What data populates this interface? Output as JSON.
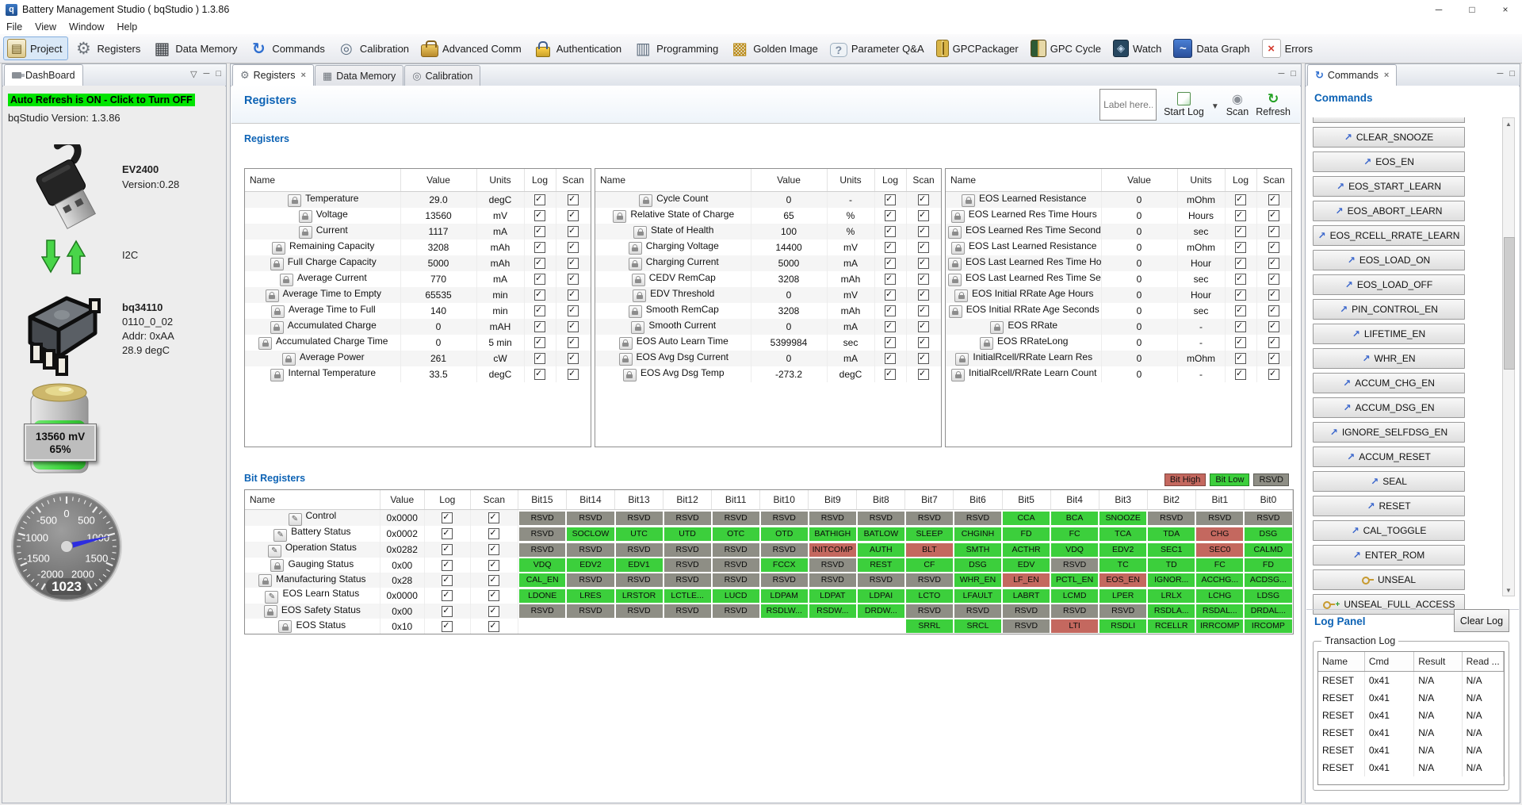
{
  "titlebar": {
    "title": "Battery Management Studio ( bqStudio ) 1.3.86"
  },
  "menubar": [
    "File",
    "View",
    "Window",
    "Help"
  ],
  "toolbar": [
    {
      "id": "project",
      "label": "Project",
      "selected": true
    },
    {
      "id": "registers",
      "label": "Registers",
      "selected": false
    },
    {
      "id": "data-memory",
      "label": "Data Memory",
      "selected": false
    },
    {
      "id": "commands",
      "label": "Commands",
      "selected": false
    },
    {
      "id": "calibration",
      "label": "Calibration",
      "selected": false
    },
    {
      "id": "advanced-comm",
      "label": "Advanced Comm",
      "selected": false
    },
    {
      "id": "authentication",
      "label": "Authentication",
      "selected": false
    },
    {
      "id": "programming",
      "label": "Programming",
      "selected": false
    },
    {
      "id": "golden-image",
      "label": "Golden Image",
      "selected": false
    },
    {
      "id": "parameter-qa",
      "label": "Parameter Q&A",
      "selected": false
    },
    {
      "id": "gpcpackager",
      "label": "GPCPackager",
      "selected": false
    },
    {
      "id": "gpc-cycle",
      "label": "GPC Cycle",
      "selected": false
    },
    {
      "id": "watch",
      "label": "Watch",
      "selected": false
    },
    {
      "id": "data-graph",
      "label": "Data Graph",
      "selected": false
    },
    {
      "id": "errors",
      "label": "Errors",
      "selected": false
    }
  ],
  "dashboard": {
    "tab": "DashBoard",
    "banner": "Auto Refresh is ON - Click to Turn OFF",
    "version": "bqStudio Version:  1.3.86",
    "adapter_name": "EV2400",
    "adapter_version": "Version:0.28",
    "bus_label": "I2C",
    "device": {
      "name": "bq34110",
      "fw": "0110_0_02",
      "addr": "Addr: 0xAA",
      "temp": "28.9 degC"
    },
    "battery": {
      "voltage": "13560 mV",
      "soc": "65%"
    },
    "gauge": {
      "tick_labels": [
        "0",
        "-500",
        "500",
        "-1000",
        "1000",
        "-1500",
        "1500",
        "-2000",
        "2000"
      ],
      "value": "1023"
    }
  },
  "main": {
    "tabs": [
      {
        "label": "Registers",
        "icon": "gear",
        "active": true,
        "closable": true
      },
      {
        "label": "Data Memory",
        "icon": "chip",
        "active": false,
        "closable": false
      },
      {
        "label": "Calibration",
        "icon": "magnifier",
        "active": false,
        "closable": false
      }
    ],
    "page_title": "Registers",
    "label_placeholder": "Label here...",
    "actions": {
      "start_log": "Start Log",
      "scan": "Scan",
      "refresh": "Refresh"
    },
    "registers_section_title": "Registers",
    "reg_columns": [
      "Name",
      "Value",
      "Units",
      "Log",
      "Scan"
    ],
    "reg_tables": [
      [
        [
          "Temperature",
          "29.0",
          "degC"
        ],
        [
          "Voltage",
          "13560",
          "mV"
        ],
        [
          "Current",
          "1117",
          "mA"
        ],
        [
          "Remaining Capacity",
          "3208",
          "mAh"
        ],
        [
          "Full Charge Capacity",
          "5000",
          "mAh"
        ],
        [
          "Average Current",
          "770",
          "mA"
        ],
        [
          "Average Time to Empty",
          "65535",
          "min"
        ],
        [
          "Average Time to Full",
          "140",
          "min"
        ],
        [
          "Accumulated Charge",
          "0",
          "mAH"
        ],
        [
          "Accumulated Charge Time",
          "0",
          "5 min"
        ],
        [
          "Average Power",
          "261",
          "cW"
        ],
        [
          "Internal Temperature",
          "33.5",
          "degC"
        ]
      ],
      [
        [
          "Cycle Count",
          "0",
          "-"
        ],
        [
          "Relative State of Charge",
          "65",
          "%"
        ],
        [
          "State of Health",
          "100",
          "%"
        ],
        [
          "Charging Voltage",
          "14400",
          "mV"
        ],
        [
          "Charging Current",
          "5000",
          "mA"
        ],
        [
          "CEDV RemCap",
          "3208",
          "mAh"
        ],
        [
          "EDV Threshold",
          "0",
          "mV"
        ],
        [
          "Smooth RemCap",
          "3208",
          "mAh"
        ],
        [
          "Smooth Current",
          "0",
          "mA"
        ],
        [
          "EOS Auto Learn Time",
          "5399984",
          "sec"
        ],
        [
          "EOS Avg Dsg Current",
          "0",
          "mA"
        ],
        [
          "EOS Avg Dsg Temp",
          "-273.2",
          "degC"
        ]
      ],
      [
        [
          "EOS Learned Resistance",
          "0",
          "mOhm"
        ],
        [
          "EOS Learned Res Time Hours",
          "0",
          "Hours"
        ],
        [
          "EOS Learned Res Time Seconds",
          "0",
          "sec"
        ],
        [
          "EOS Last Learned Resistance",
          "0",
          "mOhm"
        ],
        [
          "EOS Last Learned Res Time Ho...",
          "0",
          "Hour"
        ],
        [
          "EOS Last Learned Res Time Se...",
          "0",
          "sec"
        ],
        [
          "EOS Initial RRate Age Hours",
          "0",
          "Hour"
        ],
        [
          "EOS Initial RRate Age Seconds",
          "0",
          "sec"
        ],
        [
          "EOS RRate",
          "0",
          "-"
        ],
        [
          "EOS RRateLong",
          "0",
          "-"
        ],
        [
          "InitialRcell/RRate Learn Res",
          "0",
          "mOhm"
        ],
        [
          "InitialRcell/RRate Learn Count",
          "0",
          "-"
        ]
      ]
    ],
    "bit_section_title": "Bit Registers",
    "bit_legend": [
      {
        "label": "Bit High",
        "type": "high"
      },
      {
        "label": "Bit Low",
        "type": "low"
      },
      {
        "label": "RSVD",
        "type": "rsvd"
      }
    ],
    "bit_columns": [
      "Name",
      "Value",
      "Log",
      "Scan",
      "Bit15",
      "Bit14",
      "Bit13",
      "Bit12",
      "Bit11",
      "Bit10",
      "Bit9",
      "Bit8",
      "Bit7",
      "Bit6",
      "Bit5",
      "Bit4",
      "Bit3",
      "Bit2",
      "Bit1",
      "Bit0"
    ],
    "bit_rows": [
      {
        "name": "Control",
        "value": "0x0000",
        "icon": "pencil",
        "bits": [
          [
            "RSVD",
            "rsvd"
          ],
          [
            "RSVD",
            "rsvd"
          ],
          [
            "RSVD",
            "rsvd"
          ],
          [
            "RSVD",
            "rsvd"
          ],
          [
            "RSVD",
            "rsvd"
          ],
          [
            "RSVD",
            "rsvd"
          ],
          [
            "RSVD",
            "rsvd"
          ],
          [
            "RSVD",
            "rsvd"
          ],
          [
            "RSVD",
            "rsvd"
          ],
          [
            "RSVD",
            "rsvd"
          ],
          [
            "CCA",
            "low"
          ],
          [
            "BCA",
            "low"
          ],
          [
            "SNOOZE",
            "low"
          ],
          [
            "RSVD",
            "rsvd"
          ],
          [
            "RSVD",
            "rsvd"
          ],
          [
            "RSVD",
            "rsvd"
          ]
        ]
      },
      {
        "name": "Battery Status",
        "value": "0x0002",
        "icon": "pencil",
        "bits": [
          [
            "RSVD",
            "rsvd"
          ],
          [
            "SOCLOW",
            "low"
          ],
          [
            "UTC",
            "low"
          ],
          [
            "UTD",
            "low"
          ],
          [
            "OTC",
            "low"
          ],
          [
            "OTD",
            "low"
          ],
          [
            "BATHIGH",
            "low"
          ],
          [
            "BATLOW",
            "low"
          ],
          [
            "SLEEP",
            "low"
          ],
          [
            "CHGINH",
            "low"
          ],
          [
            "FD",
            "low"
          ],
          [
            "FC",
            "low"
          ],
          [
            "TCA",
            "low"
          ],
          [
            "TDA",
            "low"
          ],
          [
            "CHG",
            "high"
          ],
          [
            "DSG",
            "low"
          ]
        ]
      },
      {
        "name": "Operation Status",
        "value": "0x0282",
        "icon": "pencil",
        "bits": [
          [
            "RSVD",
            "rsvd"
          ],
          [
            "RSVD",
            "rsvd"
          ],
          [
            "RSVD",
            "rsvd"
          ],
          [
            "RSVD",
            "rsvd"
          ],
          [
            "RSVD",
            "rsvd"
          ],
          [
            "RSVD",
            "rsvd"
          ],
          [
            "INITCOMP",
            "high"
          ],
          [
            "AUTH",
            "low"
          ],
          [
            "BLT",
            "high"
          ],
          [
            "SMTH",
            "low"
          ],
          [
            "ACTHR",
            "low"
          ],
          [
            "VDQ",
            "low"
          ],
          [
            "EDV2",
            "low"
          ],
          [
            "SEC1",
            "low"
          ],
          [
            "SEC0",
            "high"
          ],
          [
            "CALMD",
            "low"
          ]
        ]
      },
      {
        "name": "Gauging Status",
        "value": "0x00",
        "icon": "lock",
        "bits": [
          [
            "VDQ",
            "low"
          ],
          [
            "EDV2",
            "low"
          ],
          [
            "EDV1",
            "low"
          ],
          [
            "RSVD",
            "rsvd"
          ],
          [
            "RSVD",
            "rsvd"
          ],
          [
            "FCCX",
            "low"
          ],
          [
            "RSVD",
            "rsvd"
          ],
          [
            "REST",
            "low"
          ],
          [
            "CF",
            "low"
          ],
          [
            "DSG",
            "low"
          ],
          [
            "EDV",
            "low"
          ],
          [
            "RSVD",
            "rsvd"
          ],
          [
            "TC",
            "low"
          ],
          [
            "TD",
            "low"
          ],
          [
            "FC",
            "low"
          ],
          [
            "FD",
            "low"
          ]
        ]
      },
      {
        "name": "Manufacturing Status",
        "value": "0x28",
        "icon": "lock",
        "bits": [
          [
            "CAL_EN",
            "low"
          ],
          [
            "RSVD",
            "rsvd"
          ],
          [
            "RSVD",
            "rsvd"
          ],
          [
            "RSVD",
            "rsvd"
          ],
          [
            "RSVD",
            "rsvd"
          ],
          [
            "RSVD",
            "rsvd"
          ],
          [
            "RSVD",
            "rsvd"
          ],
          [
            "RSVD",
            "rsvd"
          ],
          [
            "RSVD",
            "rsvd"
          ],
          [
            "WHR_EN",
            "low"
          ],
          [
            "LF_EN",
            "high"
          ],
          [
            "PCTL_EN",
            "low"
          ],
          [
            "EOS_EN",
            "high"
          ],
          [
            "IGNOR...",
            "low"
          ],
          [
            "ACCHG...",
            "low"
          ],
          [
            "ACDSG...",
            "low"
          ]
        ]
      },
      {
        "name": "EOS Learn Status",
        "value": "0x0000",
        "icon": "pencil",
        "bits": [
          [
            "LDONE",
            "low"
          ],
          [
            "LRES",
            "low"
          ],
          [
            "LRSTOR",
            "low"
          ],
          [
            "LCTLE...",
            "low"
          ],
          [
            "LUCD",
            "low"
          ],
          [
            "LDPAM",
            "low"
          ],
          [
            "LDPAT",
            "low"
          ],
          [
            "LDPAI",
            "low"
          ],
          [
            "LCTO",
            "low"
          ],
          [
            "LFAULT",
            "low"
          ],
          [
            "LABRT",
            "low"
          ],
          [
            "LCMD",
            "low"
          ],
          [
            "LPER",
            "low"
          ],
          [
            "LRLX",
            "low"
          ],
          [
            "LCHG",
            "low"
          ],
          [
            "LDSG",
            "low"
          ]
        ]
      },
      {
        "name": "EOS Safety Status",
        "value": "0x00",
        "icon": "lock",
        "bits": [
          [
            "RSVD",
            "rsvd"
          ],
          [
            "RSVD",
            "rsvd"
          ],
          [
            "RSVD",
            "rsvd"
          ],
          [
            "RSVD",
            "rsvd"
          ],
          [
            "RSVD",
            "rsvd"
          ],
          [
            "RSDLW...",
            "low"
          ],
          [
            "RSDW...",
            "low"
          ],
          [
            "DRDW...",
            "low"
          ],
          [
            "RSVD",
            "rsvd"
          ],
          [
            "RSVD",
            "rsvd"
          ],
          [
            "RSVD",
            "rsvd"
          ],
          [
            "RSVD",
            "rsvd"
          ],
          [
            "RSVD",
            "rsvd"
          ],
          [
            "RSDLA...",
            "low"
          ],
          [
            "RSDAL...",
            "low"
          ],
          [
            "DRDAL...",
            "low"
          ]
        ]
      },
      {
        "name": "EOS Status",
        "value": "0x10",
        "icon": "lock",
        "bits": [
          [
            "",
            "none"
          ],
          [
            "",
            "none"
          ],
          [
            "",
            "none"
          ],
          [
            "",
            "none"
          ],
          [
            "",
            "none"
          ],
          [
            "",
            "none"
          ],
          [
            "",
            "none"
          ],
          [
            "",
            "none"
          ],
          [
            "SRRL",
            "low"
          ],
          [
            "SRCL",
            "low"
          ],
          [
            "RSVD",
            "rsvd"
          ],
          [
            "LTI",
            "high"
          ],
          [
            "RSDLI",
            "low"
          ],
          [
            "RCELLR",
            "low"
          ],
          [
            "IRRCOMP",
            "low"
          ],
          [
            "IRCOMP",
            "low"
          ]
        ]
      }
    ]
  },
  "commands_panel": {
    "tab": "Commands",
    "title": "Commands",
    "buttons": [
      {
        "label": "CLEAR_SNOOZE",
        "icon": "arrow"
      },
      {
        "label": "EOS_EN",
        "icon": "arrow"
      },
      {
        "label": "EOS_START_LEARN",
        "icon": "arrow"
      },
      {
        "label": "EOS_ABORT_LEARN",
        "icon": "arrow"
      },
      {
        "label": "EOS_RCELL_RRATE_LEARN",
        "icon": "arrow"
      },
      {
        "label": "EOS_LOAD_ON",
        "icon": "arrow"
      },
      {
        "label": "EOS_LOAD_OFF",
        "icon": "arrow"
      },
      {
        "label": "PIN_CONTROL_EN",
        "icon": "arrow"
      },
      {
        "label": "LIFETIME_EN",
        "icon": "arrow"
      },
      {
        "label": "WHR_EN",
        "icon": "arrow"
      },
      {
        "label": "ACCUM_CHG_EN",
        "icon": "arrow"
      },
      {
        "label": "ACCUM_DSG_EN",
        "icon": "arrow"
      },
      {
        "label": "IGNORE_SELFDSG_EN",
        "icon": "arrow"
      },
      {
        "label": "ACCUM_RESET",
        "icon": "arrow"
      },
      {
        "label": "SEAL",
        "icon": "arrow"
      },
      {
        "label": "RESET",
        "icon": "arrow"
      },
      {
        "label": "CAL_TOGGLE",
        "icon": "arrow"
      },
      {
        "label": "ENTER_ROM",
        "icon": "arrow"
      },
      {
        "label": "UNSEAL",
        "icon": "key"
      },
      {
        "label": "UNSEAL_FULL_ACCESS",
        "icon": "key-plus"
      }
    ],
    "log_panel": {
      "title": "Log Panel",
      "clear_button": "Clear Log",
      "group_title": "Transaction Log",
      "columns": [
        "Name",
        "Cmd",
        "Result",
        "Read ..."
      ],
      "rows": [
        [
          "RESET",
          "0x41",
          "N/A",
          "N/A"
        ],
        [
          "RESET",
          "0x41",
          "N/A",
          "N/A"
        ],
        [
          "RESET",
          "0x41",
          "N/A",
          "N/A"
        ],
        [
          "RESET",
          "0x41",
          "N/A",
          "N/A"
        ],
        [
          "RESET",
          "0x41",
          "N/A",
          "N/A"
        ],
        [
          "RESET",
          "0x41",
          "N/A",
          "N/A"
        ]
      ]
    }
  },
  "colors": {
    "high": "#c4685f",
    "low": "#3ccf3c",
    "rsvd": "#8e8e85",
    "heading": "#0d63b5",
    "banner": "#00e400"
  }
}
